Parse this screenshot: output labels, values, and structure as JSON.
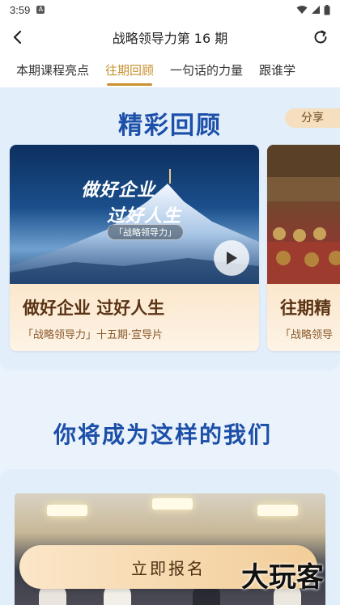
{
  "status_bar": {
    "time": "3:59",
    "notification_badge": "A",
    "icons": [
      "wifi-icon",
      "signal-icon",
      "battery-icon"
    ]
  },
  "nav": {
    "title": "战略领导力第 16 期",
    "back_icon": "back-arrow-icon",
    "refresh_icon": "refresh-icon"
  },
  "tabs": [
    {
      "label": "本期课程亮点",
      "active": false
    },
    {
      "label": "往期回顾",
      "active": true
    },
    {
      "label": "一句话的力量",
      "active": false
    },
    {
      "label": "跟谁学",
      "active": false
    }
  ],
  "review": {
    "title": "精彩回顾",
    "share_label": "分享",
    "cards": [
      {
        "heading": "做好企业 过好人生",
        "subtitle": "「战略领导力」十五期·宣导片",
        "poster_line1": "做好企业",
        "poster_line2": "过好人生",
        "poster_badge": "「战略领导力」"
      },
      {
        "heading": "往期精",
        "subtitle": "「战略领导"
      }
    ]
  },
  "become": {
    "title": "你将成为这样的我们"
  },
  "signup": {
    "label": "立即报名"
  },
  "watermark": {
    "text": "大玩客"
  },
  "colors": {
    "accent": "#c8902f",
    "title_blue": "#1c4fa8",
    "panel_bg": "#e3eefb"
  }
}
